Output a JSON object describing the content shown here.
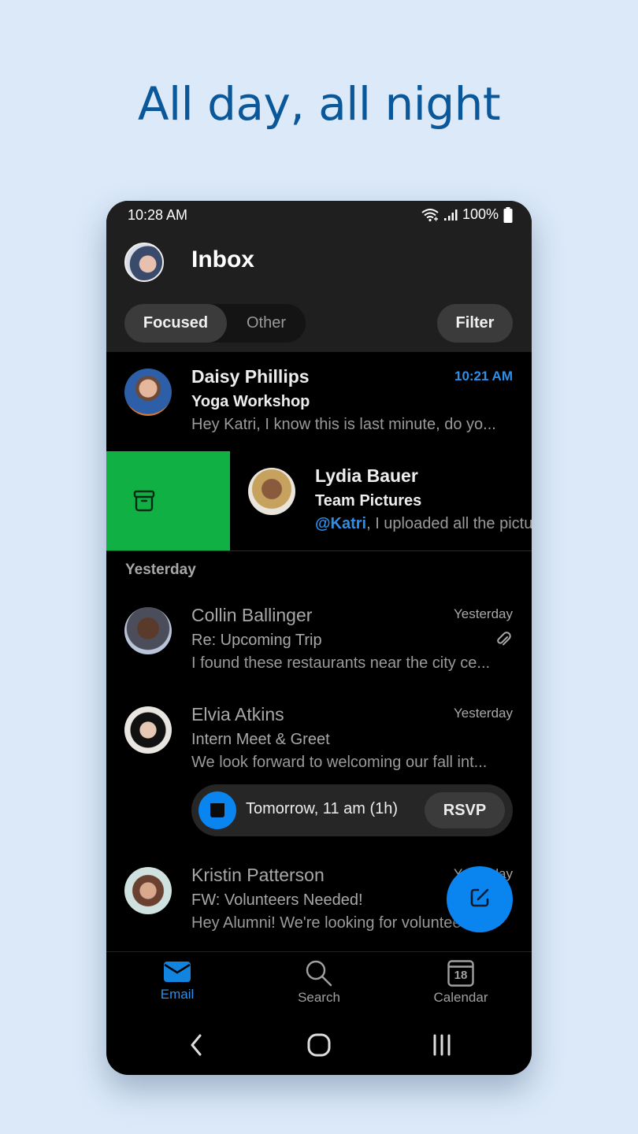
{
  "headline": "All day, all night",
  "status_bar": {
    "time": "10:28 AM",
    "battery": "100%",
    "icons": [
      "wifi-icon",
      "signal-icon",
      "battery-icon"
    ]
  },
  "header": {
    "title": "Inbox",
    "pivot": {
      "focused_label": "Focused",
      "other_label": "Other",
      "selected": "Focused"
    },
    "filter_label": "Filter"
  },
  "messages_today": [
    {
      "sender": "Daisy Phillips",
      "subject": "Yoga Workshop",
      "preview": "Hey Katri, I know this is last minute, do yo...",
      "time": "10:21 AM",
      "unread": true
    },
    {
      "sender": "Lydia Bauer",
      "subject": "Team Pictures",
      "mention": "@Katri",
      "preview": ", I uploaded all the pictures",
      "unread": true,
      "swipe_action": "archive-icon"
    }
  ],
  "section_yesterday": "Yesterday",
  "messages_yesterday": [
    {
      "sender": "Collin Ballinger",
      "subject": "Re: Upcoming Trip",
      "preview": "I found these restaurants near the city ce...",
      "time": "Yesterday",
      "has_attachment": true
    },
    {
      "sender": "Elvia Atkins",
      "subject": "Intern Meet & Greet",
      "preview": "We look forward to welcoming our fall int...",
      "time": "Yesterday",
      "event": {
        "text": "Tomorrow, 11 am (1h)",
        "rsvp_label": "RSVP"
      }
    },
    {
      "sender": "Kristin Patterson",
      "subject": "FW: Volunteers Needed!",
      "preview": "Hey Alumni! We're looking for volunteers",
      "time": "Yesterday"
    }
  ],
  "fab": {
    "icon": "compose-icon"
  },
  "bottom_nav": [
    {
      "label": "Email",
      "icon": "mail-icon",
      "active": true
    },
    {
      "label": "Search",
      "icon": "search-icon",
      "active": false
    },
    {
      "label": "Calendar",
      "icon": "calendar-icon",
      "calendar_day": "18",
      "active": false
    }
  ],
  "system_nav": [
    "back-icon",
    "home-icon",
    "recents-icon"
  ],
  "colors": {
    "accent": "#0a84ee",
    "swipe_archive": "#10b045",
    "headline": "#0a5799",
    "background": "#dbe9f8"
  }
}
